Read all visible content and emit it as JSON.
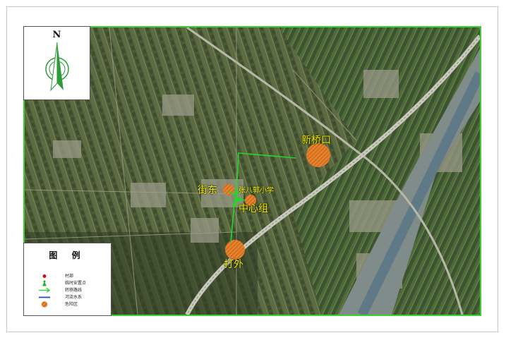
{
  "map": {
    "places": {
      "xinqiaokou": "新桥口",
      "jiedong": "街东",
      "school": "张八郭小学",
      "center_group": "中心组",
      "dawai": "打外"
    },
    "colors": {
      "route": "#22d62a",
      "frame": "#3ad12f",
      "danger_fill": "#e8822a",
      "label": "#f5f000",
      "village_dot": "#cc1111"
    }
  },
  "north_arrow": {
    "letter": "N"
  },
  "legend": {
    "title": "图 例",
    "items": [
      {
        "symbol": "village-dot-icon",
        "label": "村部"
      },
      {
        "symbol": "shelter-icon",
        "label": "临时安置点"
      },
      {
        "symbol": "arrow-icon",
        "label": "转移路线"
      },
      {
        "symbol": "water-line-icon",
        "label": "河流水系"
      },
      {
        "symbol": "hatched-circle-icon",
        "label": "危险区"
      }
    ]
  }
}
